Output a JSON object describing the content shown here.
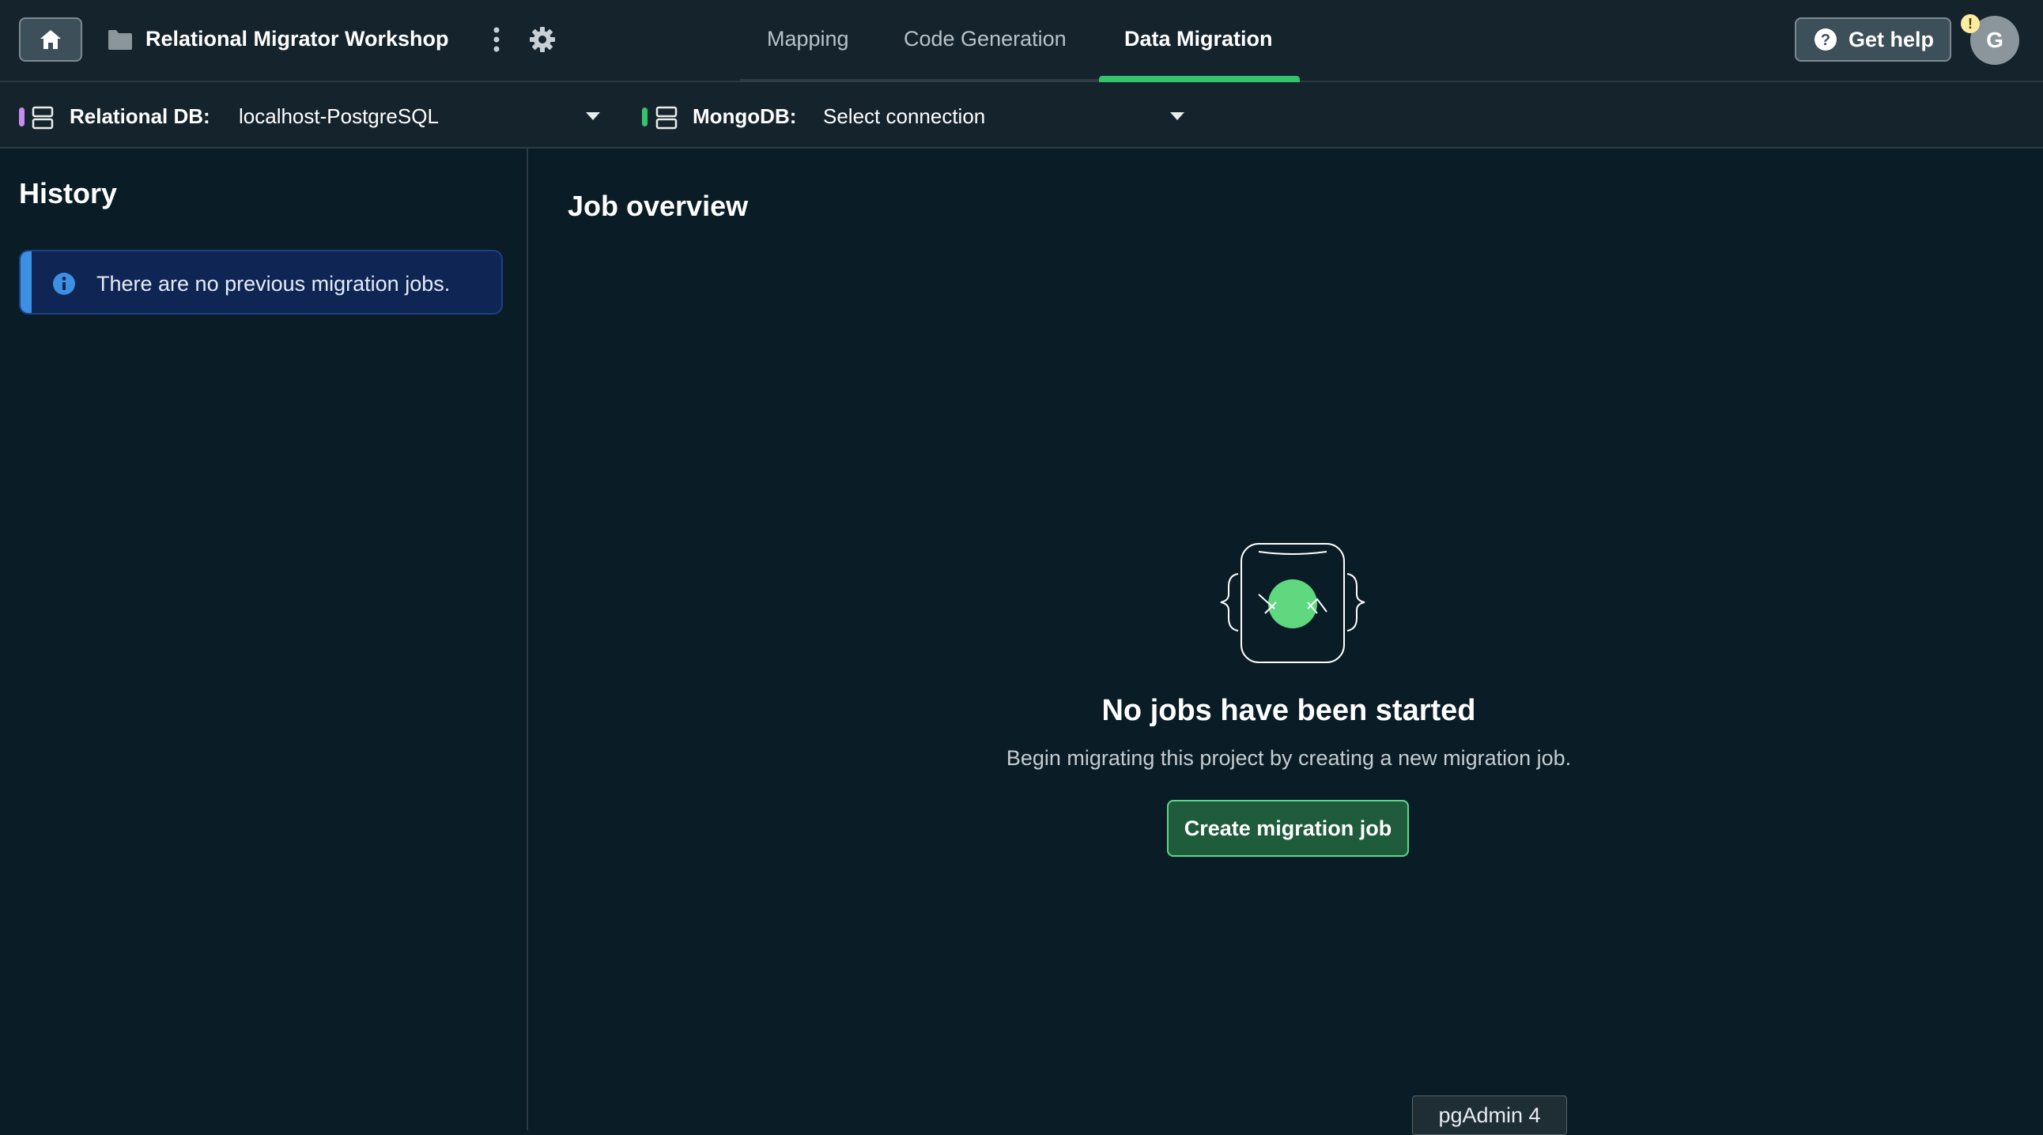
{
  "header": {
    "project_title": "Relational Migrator Workshop",
    "tabs": [
      {
        "label": "Mapping",
        "active": false
      },
      {
        "label": "Code Generation",
        "active": false
      },
      {
        "label": "Data Migration",
        "active": true
      }
    ],
    "help_label": "Get help",
    "avatar_initial": "G",
    "alert_mark": "!"
  },
  "connections": {
    "relational": {
      "label": "Relational DB:",
      "value": "localhost-PostgreSQL",
      "indicator_color": "#c58cf0"
    },
    "mongodb": {
      "label": "MongoDB:",
      "value": "Select connection",
      "indicator_color": "#34c46b"
    }
  },
  "sidebar": {
    "title": "History",
    "info_message": "There are no previous migration jobs."
  },
  "main": {
    "title": "Job overview",
    "empty_title": "No jobs have been started",
    "empty_subtitle": "Begin migrating this project by creating a new migration job.",
    "create_button": "Create migration job"
  },
  "tooltip": "pgAdmin 4",
  "colors": {
    "accent_green": "#34c46b",
    "info_blue": "#3d8fe3",
    "background": "#0a1c26"
  }
}
